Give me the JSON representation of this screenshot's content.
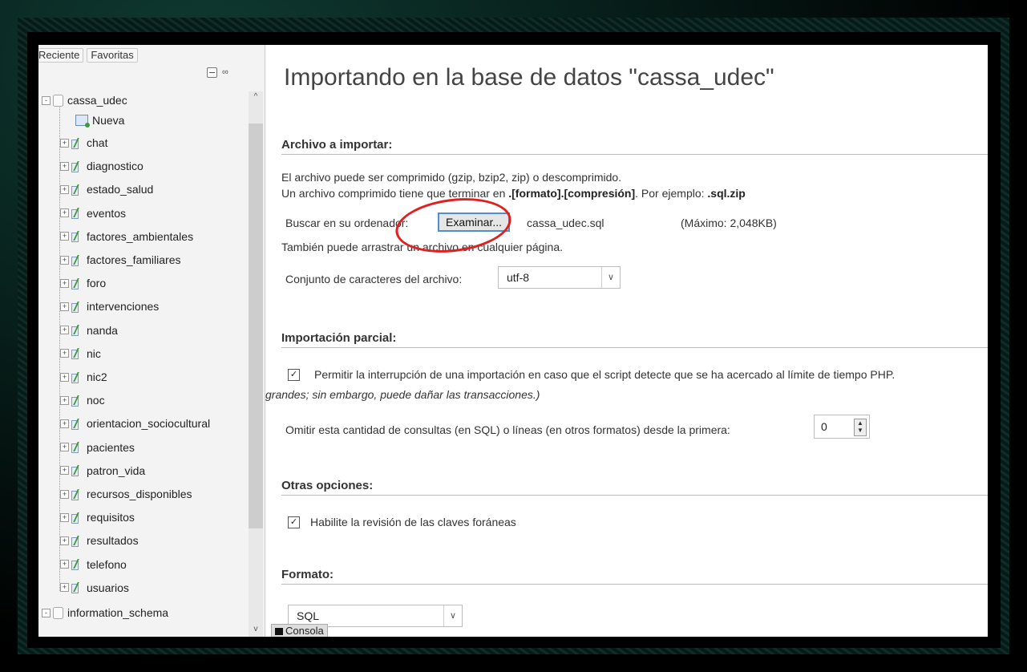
{
  "nav": {
    "tabs": [
      "Reciente",
      "Favoritas"
    ],
    "link_icon": "∞",
    "database": "cassa_udec",
    "new_label": "Nueva",
    "tables": [
      "chat",
      "diagnostico",
      "estado_salud",
      "eventos",
      "factores_ambientales",
      "factores_familiares",
      "foro",
      "intervenciones",
      "nanda",
      "nic",
      "nic2",
      "noc",
      "orientacion_sociocultural",
      "pacientes",
      "patron_vida",
      "recursos_disponibles",
      "requisitos",
      "resultados",
      "telefono",
      "usuarios"
    ],
    "other_database": "information_schema"
  },
  "main": {
    "title": "Importando en la base de datos \"cassa_udec\"",
    "file_section": {
      "heading": "Archivo a importar:",
      "line1": "El archivo puede ser comprimido (gzip, bzip2, zip) o descomprimido.",
      "line2_prefix": "Un archivo comprimido tiene que terminar en ",
      "line2_format": ".[formato].[compresión]",
      "line2_mid": ". Por ejemplo: ",
      "line2_example": ".sql.zip",
      "browse_label": "Buscar en su ordenador:",
      "browse_button": "Examinar...",
      "file_name": "cassa_udec.sql",
      "max_size": "(Máximo: 2,048KB)",
      "drag_hint": "También puede arrastrar un archivo en cualquier página.",
      "charset_label": "Conjunto de caracteres del archivo:",
      "charset_value": "utf-8"
    },
    "partial_section": {
      "heading": "Importación parcial:",
      "allow_interrupt": "Permitir la interrupción de una importación en caso que el script detecte que se ha acercado al límite de tiempo PHP.",
      "allow_interrupt_note": "grandes; sin embargo, puede dañar las transacciones.)",
      "skip_label": "Omitir esta cantidad de consultas (en SQL) o líneas (en otros formatos) desde la primera:",
      "skip_value": "0"
    },
    "other_section": {
      "heading": "Otras opciones:",
      "fk_check": "Habilite la revisión de las claves foráneas"
    },
    "format_section": {
      "heading": "Formato:",
      "format_value": "SQL"
    }
  },
  "console": {
    "label": "Consola"
  },
  "colors": {
    "annotation": "#e02020",
    "button_border": "#4d8fd1"
  }
}
